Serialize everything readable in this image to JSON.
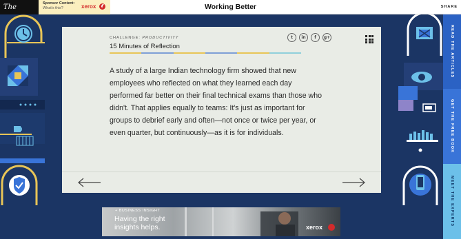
{
  "header": {
    "logo_text": "The Atlantic",
    "sponsor_label": "Sponsor Content:",
    "sponsor_sub": "What's this?",
    "sponsor_brand": "xerox",
    "title": "Working Better",
    "share_label": "SHARE"
  },
  "card": {
    "kicker_prefix": "CHALLENGE:",
    "kicker_category": "PRODUCTIVITY",
    "title": "15 Minutes of Reflection",
    "stripe_colors": [
      "#e8c557",
      "#7e9fd6",
      "#e8c557",
      "#7e9fd6",
      "#e8c557",
      "#8fcfdb"
    ],
    "social": [
      {
        "name": "twitter-icon",
        "glyph": "t"
      },
      {
        "name": "linkedin-icon",
        "glyph": "in"
      },
      {
        "name": "facebook-icon",
        "glyph": "f"
      },
      {
        "name": "googleplus-icon",
        "glyph": "g+"
      }
    ],
    "body": "A study of a large Indian technology firm showed that new employees who reflected on what they learned each day performed far better on their final technical exams than those who didn't. That applies equally to teams: It's just as important for groups to debrief early and often—not once or twice per year, or even quarter, but continuously—as it is for individuals."
  },
  "rail": {
    "read": "READ THE ARTICLES",
    "book": "GET THE FREE BOOK",
    "experts": "MEET THE EXPERTS"
  },
  "ad": {
    "kicker": "+ BUSINESS INSIGHT",
    "headline": "Having the right insights helps.",
    "brand": "xerox"
  },
  "colors": {
    "background": "#1b3564",
    "card": "#e9ece6",
    "accent_yellow": "#e8c557",
    "accent_blue": "#3974d8",
    "accent_light": "#6cc0e9"
  }
}
